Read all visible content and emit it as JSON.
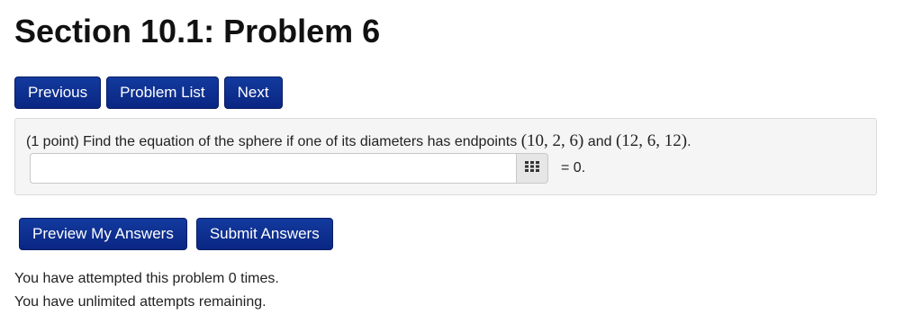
{
  "page": {
    "title": "Section 10.1: Problem 6"
  },
  "nav": {
    "previous": "Previous",
    "problem_list": "Problem List",
    "next": "Next"
  },
  "problem": {
    "points": "(1 point)",
    "text": " Find the equation of the sphere if one of its diameters has endpoints ",
    "point1": "(10, 2, 6)",
    "and": " and ",
    "point2": "(12, 6, 12)",
    "period": ".",
    "answer_value": "",
    "equals_suffix": "= 0."
  },
  "actions": {
    "preview": "Preview My Answers",
    "submit": "Submit Answers"
  },
  "status": {
    "attempts": "You have attempted this problem 0 times.",
    "remaining": "You have unlimited attempts remaining."
  },
  "icons": {
    "palette": "grid-icon"
  }
}
